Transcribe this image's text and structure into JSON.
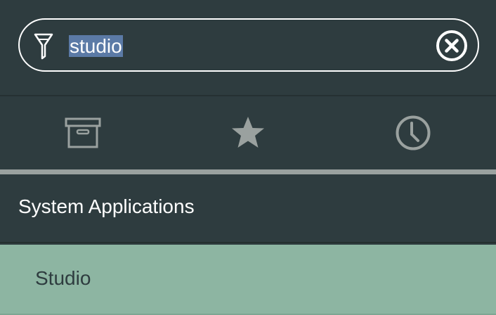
{
  "filter": {
    "value": "studio",
    "icon": "filter-icon",
    "clear_icon": "clear-circle-x-icon"
  },
  "tabs": [
    {
      "name": "all-apps",
      "icon": "archive-box-icon",
      "active": true
    },
    {
      "name": "favorites",
      "icon": "star-icon",
      "active": false
    },
    {
      "name": "history",
      "icon": "clock-icon",
      "active": false
    }
  ],
  "section": {
    "title": "System Applications"
  },
  "results": [
    {
      "label": "Studio",
      "highlighted": true
    }
  ],
  "colors": {
    "background": "#2e3c3f",
    "selection": "#5b7aa6",
    "highlight_row": "#8db5a2",
    "tab_underline": "#9aa19f",
    "icon_gray": "#9aa19f"
  }
}
